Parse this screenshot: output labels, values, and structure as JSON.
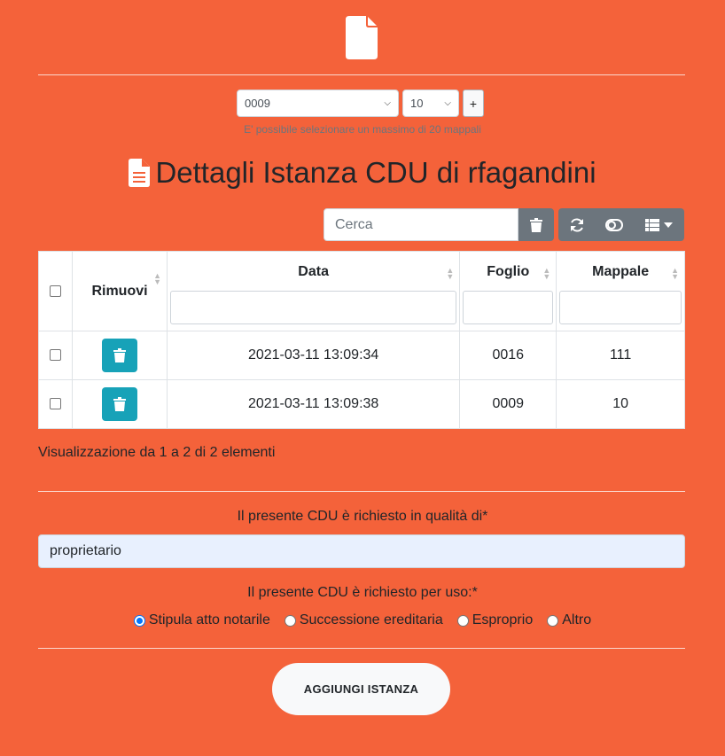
{
  "header": {
    "icon": "file-icon"
  },
  "selectors": {
    "foglio_value": "0009",
    "mappale_value": "10",
    "add_label": "+",
    "hint": "E' possibile selezionare un massimo di 20 mappali"
  },
  "title": {
    "text": "Dettagli Istanza CDU di rfagandini",
    "icon": "file-alt-icon"
  },
  "toolbar": {
    "search_placeholder": "Cerca",
    "icons": [
      "trash-icon",
      "refresh-icon",
      "toggle-icon",
      "columns-icon"
    ]
  },
  "table": {
    "columns": [
      "Rimuovi",
      "Data",
      "Foglio",
      "Mappale"
    ],
    "rows": [
      {
        "data": "2021-03-11 13:09:34",
        "foglio": "0016",
        "mappale": "111"
      },
      {
        "data": "2021-03-11 13:09:38",
        "foglio": "0009",
        "mappale": "10"
      }
    ],
    "info": "Visualizzazione da 1 a 2 di 2 elementi"
  },
  "form": {
    "qualita_label": "Il presente CDU è richiesto in qualità di*",
    "qualita_value": "proprietario",
    "uso_label": "Il presente CDU è richiesto per uso:*",
    "uso_options": [
      "Stipula atto notarile",
      "Successione ereditaria",
      "Esproprio",
      "Altro"
    ],
    "uso_selected": "Stipula atto notarile",
    "submit_label": "AGGIUNGI ISTANZA"
  },
  "colors": {
    "background": "#f4623a",
    "accent": "#17a2b8",
    "secondary": "#6c757d"
  }
}
